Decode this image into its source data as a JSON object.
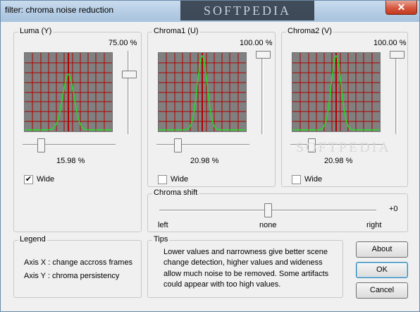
{
  "window": {
    "title": "filter: chroma noise reduction",
    "close_glyph": "✕",
    "watermark": "SOFTPEDIA"
  },
  "luma": {
    "label": "Luma (Y)",
    "top_value": "75.00 %",
    "bottom_value": "15.98 %",
    "vslider_fraction": 0.75,
    "hslider_fraction": 0.16,
    "wide_label": "Wide",
    "wide_checked": true
  },
  "chroma1": {
    "label": "Chroma1 (U)",
    "top_value": "100.00 %",
    "bottom_value": "20.98 %",
    "vslider_fraction": 1.0,
    "hslider_fraction": 0.21,
    "wide_label": "Wide",
    "wide_checked": false
  },
  "chroma2": {
    "label": "Chroma2 (V)",
    "top_value": "100.00 %",
    "bottom_value": "20.98 %",
    "vslider_fraction": 1.0,
    "hslider_fraction": 0.21,
    "wide_label": "Wide",
    "wide_checked": false
  },
  "chroma_shift": {
    "label": "Chroma shift",
    "value": "+0",
    "left_label": "left",
    "center_label": "none",
    "right_label": "right",
    "slider_fraction": 0.5
  },
  "legend": {
    "label": "Legend",
    "axis_x": "Axis X : change accross frames",
    "axis_y": "Axis Y : chroma persistency"
  },
  "tips": {
    "label": "Tips",
    "line1": "Lower values and narrowness give better scene",
    "line2": "change detection, higher values and wideness",
    "line3": "allow much noise to be removed. Some artifacts",
    "line4": "could appear with too high values."
  },
  "buttons": {
    "about": "About",
    "ok": "OK",
    "cancel": "Cancel"
  },
  "colors": {
    "graph_bg": "#808080",
    "grid_line": "#b00000",
    "curve": "#22dd22"
  }
}
